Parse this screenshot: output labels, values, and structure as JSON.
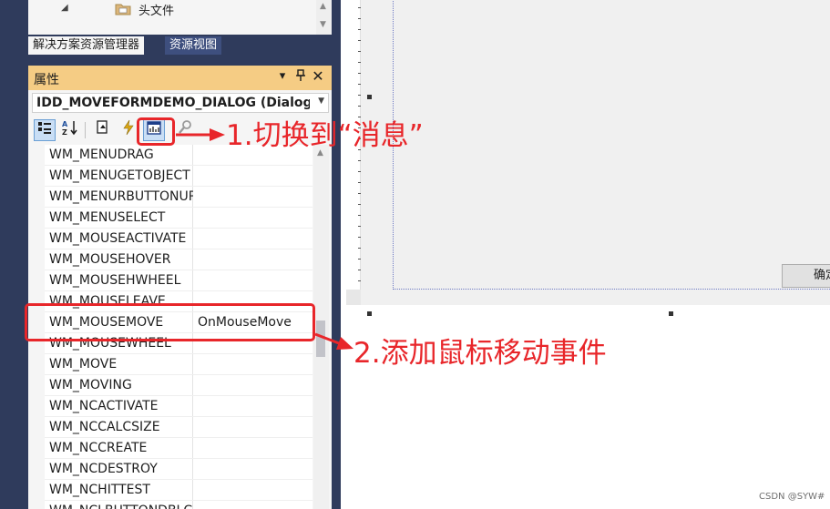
{
  "solution_tree": {
    "item_label": "头文件"
  },
  "tabs": {
    "solution_explorer": "解决方案资源管理器",
    "resource_view": "资源视图"
  },
  "properties": {
    "title": "属性",
    "object_combo": "IDD_MOVEFORMDEMO_DIALOG (Dialog",
    "toolbar": {
      "categorized_icon": "categorized-icon",
      "alphabetical_icon": "alphabetical-icon",
      "property_pages_icon": "property-pages-icon",
      "events_icon": "lightning-icon",
      "messages_icon": "messages-icon",
      "overrides_icon": "overrides-icon"
    },
    "rows": [
      {
        "name": "WM_MENUDRAG",
        "value": ""
      },
      {
        "name": "WM_MENUGETOBJECT",
        "value": ""
      },
      {
        "name": "WM_MENURBUTTONUP",
        "value": ""
      },
      {
        "name": "WM_MENUSELECT",
        "value": ""
      },
      {
        "name": "WM_MOUSEACTIVATE",
        "value": ""
      },
      {
        "name": "WM_MOUSEHOVER",
        "value": ""
      },
      {
        "name": "WM_MOUSEHWHEEL",
        "value": ""
      },
      {
        "name": "WM_MOUSELEAVE",
        "value": ""
      },
      {
        "name": "WM_MOUSEMOVE",
        "value": "OnMouseMove"
      },
      {
        "name": "WM_MOUSEWHEEL",
        "value": ""
      },
      {
        "name": "WM_MOVE",
        "value": ""
      },
      {
        "name": "WM_MOVING",
        "value": ""
      },
      {
        "name": "WM_NCACTIVATE",
        "value": ""
      },
      {
        "name": "WM_NCCALCSIZE",
        "value": ""
      },
      {
        "name": "WM_NCCREATE",
        "value": ""
      },
      {
        "name": "WM_NCDESTROY",
        "value": ""
      },
      {
        "name": "WM_NCHITTEST",
        "value": ""
      },
      {
        "name": "WM_NCLBUTTONDBLCLK",
        "value": ""
      }
    ]
  },
  "dialog": {
    "ok_button": "确定"
  },
  "annotations": {
    "step1": "1.切换到“消息”",
    "step2": "2.添加鼠标移动事件",
    "color": "#e8262a"
  },
  "watermark": "CSDN @SYW#"
}
